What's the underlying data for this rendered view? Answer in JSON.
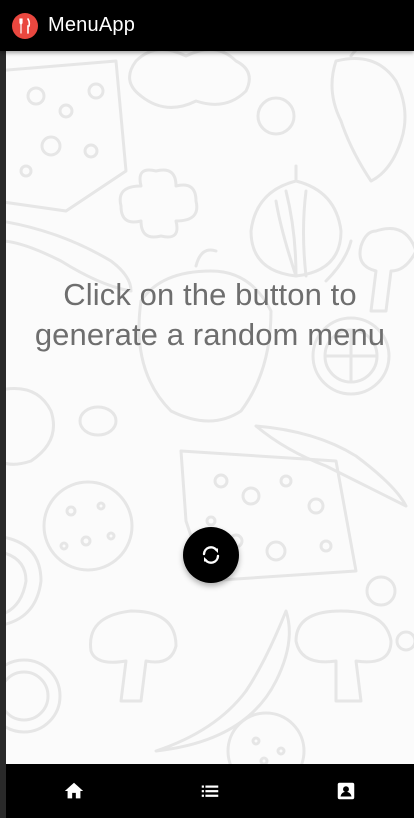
{
  "app_bar": {
    "title": "MenuApp",
    "logo_icon": "fork-knife-icon",
    "logo_color": "#e9473f"
  },
  "main": {
    "prompt_line1": "Click on the button to",
    "prompt_line2": "generate a random menu",
    "generate_button_icon": "refresh-icon"
  },
  "bottom_nav": {
    "items": [
      {
        "icon": "home-icon"
      },
      {
        "icon": "list-icon"
      },
      {
        "icon": "contact-icon"
      }
    ]
  }
}
